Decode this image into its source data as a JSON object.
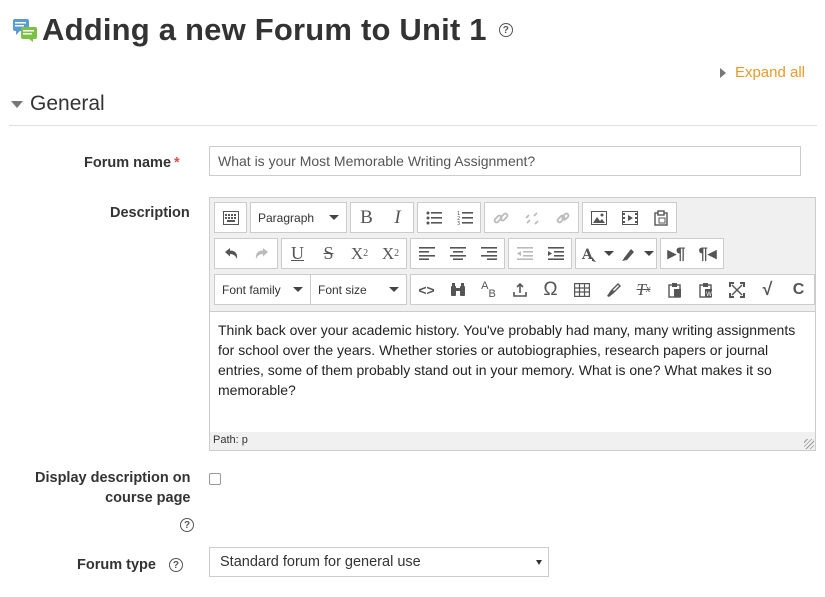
{
  "header": {
    "title": "Adding a new Forum to Unit 1"
  },
  "expand_all_label": "Expand all",
  "section": {
    "title": "General"
  },
  "form": {
    "forum_name": {
      "label": "Forum name",
      "required_marker": "*",
      "value": "What is your Most Memorable Writing Assignment?"
    },
    "description": {
      "label": "Description",
      "toolbar": {
        "paragraph_label": "Paragraph",
        "font_family_label": "Font family",
        "font_size_label": "Font size"
      },
      "body": "Think back over your academic history.   You've probably had many, many writing assignments for school over the years. Whether stories or autobiographies, research papers or journal entries, some of them probably stand out in your memory.  What is one?  What makes it so memorable?",
      "path": "Path: p"
    },
    "display_description": {
      "label_line1": "Display description on",
      "label_line2": "course page",
      "checked": false
    },
    "forum_type": {
      "label": "Forum type",
      "value": "Standard forum for general use"
    }
  },
  "icons": [
    "forum-icon",
    "help-icon",
    "expand-triangle-icon",
    "collapse-triangle-icon",
    "dropdown-caret-icon"
  ],
  "colors": {
    "link": "#e69b2a",
    "required": "#d9534f",
    "text": "#333333"
  }
}
